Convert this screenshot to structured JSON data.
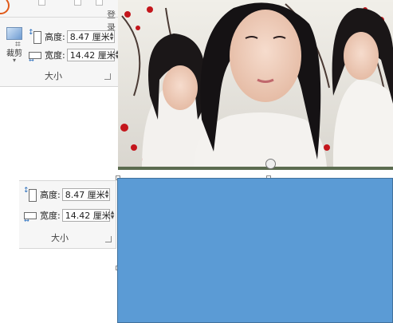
{
  "ribbon_top": {
    "sign_in": "登录",
    "crop_label": "裁剪",
    "height_label": "高度:",
    "height_value": "8.47 厘米",
    "width_label": "宽度:",
    "width_value": "14.42 厘米",
    "group_label": "大小"
  },
  "ribbon_bottom": {
    "height_label": "高度:",
    "height_value": "8.47 厘米",
    "width_label": "宽度:",
    "width_value": "14.42 厘米",
    "group_label": "大小"
  },
  "colors": {
    "shape_fill": "#5b9bd5",
    "shape_border": "#41719c",
    "ribbon_bg": "#f6f6f6"
  },
  "icons": [
    "crop-icon",
    "height-icon",
    "width-icon",
    "spin-up-icon",
    "spin-down-icon",
    "dialog-launcher-icon",
    "rotate-handle-icon"
  ]
}
